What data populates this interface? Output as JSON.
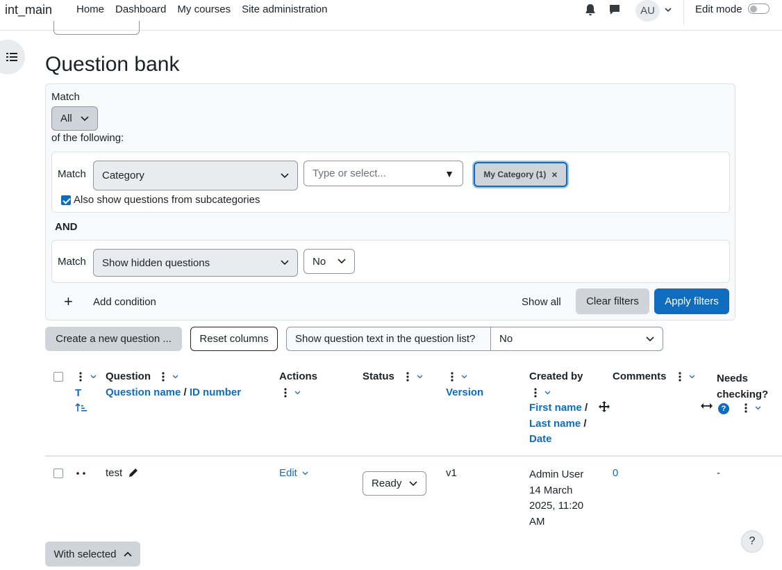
{
  "navbar": {
    "brand": "int_main",
    "links": [
      "Home",
      "Dashboard",
      "My courses",
      "Site administration"
    ],
    "avatar_initials": "AU",
    "edit_mode_label": "Edit mode"
  },
  "page": {
    "title": "Question bank"
  },
  "filters": {
    "match_label": "Match",
    "match_value": "All",
    "following_label": "of the following:",
    "conditions": [
      {
        "match_label": "Match",
        "field": "Category",
        "search_placeholder": "Type or select...",
        "chip": "My Category (1)",
        "subcategories_label": "Also show questions from subcategories",
        "subcategories_checked": true
      },
      {
        "match_label": "Match",
        "field": "Show hidden questions",
        "value": "No"
      }
    ],
    "join_label": "AND",
    "add_condition": "Add condition",
    "show_all": "Show all",
    "clear_filters": "Clear filters",
    "apply_filters": "Apply filters"
  },
  "toolbar": {
    "create_question": "Create a new question ...",
    "reset_columns": "Reset columns",
    "show_text_label": "Show question text in the question list?",
    "show_text_value": "No"
  },
  "table": {
    "headers": {
      "type_sort": "T",
      "question": "Question",
      "question_name": "Question name",
      "slash": "/",
      "id_number": "ID number",
      "actions": "Actions",
      "status": "Status",
      "version": "Version",
      "created_by": "Created by",
      "first_name": "First name",
      "last_name": "Last name",
      "date": "Date",
      "comments": "Comments",
      "needs_checking": "Needs checking?"
    },
    "rows": [
      {
        "name": "test",
        "action": "Edit",
        "status": "Ready",
        "version": "v1",
        "creator": "Admin User",
        "date_line1": "14 March",
        "date_line2": "2025, 11:20",
        "date_line3": "AM",
        "comments": "0",
        "needs_checking": "-"
      }
    ]
  },
  "footer": {
    "with_selected": "With selected",
    "help": "?"
  },
  "colors": {
    "primary": "#0f6cbf",
    "secondary": "#ced4da",
    "panel_bg": "#f8f9fa",
    "help_icon": "#0f6cbf"
  }
}
